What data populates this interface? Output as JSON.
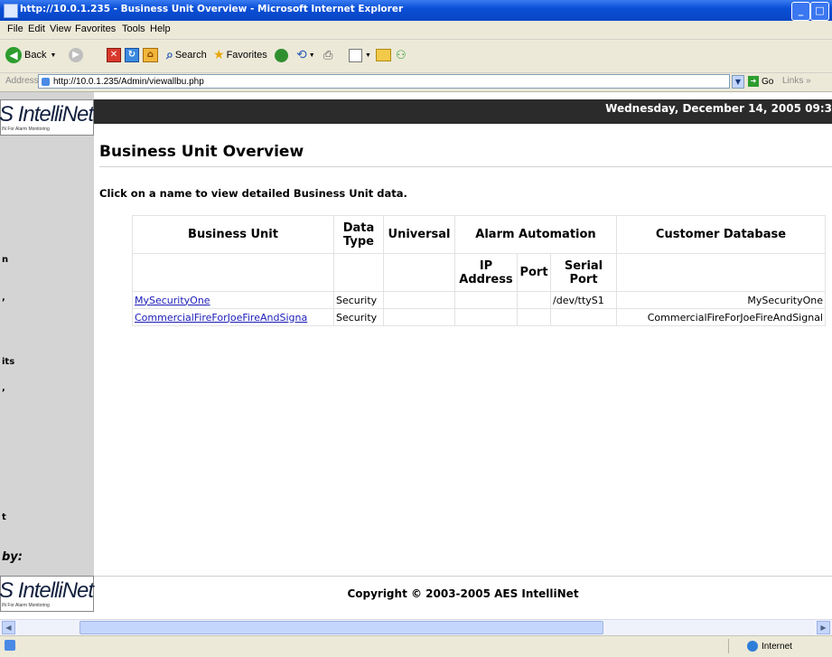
{
  "window": {
    "title": "http://10.0.1.235 - Business Unit Overview - Microsoft Internet Explorer"
  },
  "menu": [
    "File",
    "Edit",
    "View",
    "Favorites",
    "Tools",
    "Help"
  ],
  "toolbar": {
    "back_label": "Back",
    "search_label": "Search",
    "favorites_label": "Favorites"
  },
  "address": {
    "label": "Address",
    "url": "http://10.0.1.235/Admin/viewallbu.php",
    "go_label": "Go",
    "links_label": "Links"
  },
  "brand": {
    "logo_text": "IntelliNet",
    "logo_prefix": "S",
    "tagline": "IN For Alarm Monitoring"
  },
  "header": {
    "date_text": "Wednesday, December 14, 2005 09:3"
  },
  "left_nav_fragments": [
    "n",
    ",",
    "its",
    ",",
    "t"
  ],
  "page": {
    "title": "Business Unit Overview",
    "instructions": "Click on a name to view detailed Business Unit data."
  },
  "table": {
    "headers": {
      "business_unit": "Business Unit",
      "data_type": "Data Type",
      "universal": "Universal",
      "alarm_automation": "Alarm Automation",
      "customer_database": "Customer Database",
      "ip_address": "IP Address",
      "port": "Port",
      "serial_port": "Serial Port"
    },
    "rows": [
      {
        "name": "MySecurityOne",
        "data_type": "Security",
        "universal": "",
        "ip": "",
        "port": "",
        "serial": "/dev/ttyS1",
        "customer_db": "MySecurityOne"
      },
      {
        "name": "CommercialFireForJoeFireAndSigna",
        "data_type": "Security",
        "universal": "",
        "ip": "",
        "port": "",
        "serial": "",
        "customer_db": "CommercialFireForJoeFireAndSignal"
      }
    ]
  },
  "footer": {
    "by_label": "by:",
    "copyright": "Copyright © 2003-2005 AES IntelliNet"
  },
  "status": {
    "zone": "Internet"
  },
  "colors": {
    "titlebar": "#0a4fd6",
    "link": "#1b1bb8",
    "header_strip": "#2b2b2b",
    "nav_bg": "#d4d4d4"
  }
}
